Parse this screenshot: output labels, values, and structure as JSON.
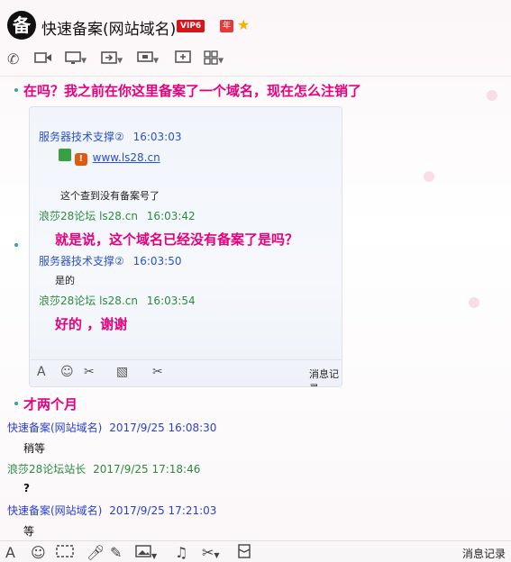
{
  "header": {
    "avatar_text": "备",
    "title": "快速备案(网站域名)",
    "vip_label": "VIP6",
    "year_label": "年"
  },
  "toolbar": {
    "icons": [
      "phone-icon",
      "video-icon",
      "screen-share-icon",
      "file-transfer-icon",
      "remote-desktop-icon",
      "add-chat-icon",
      "apps-icon"
    ]
  },
  "messages": {
    "msg1": "在吗？我之前在你这里备案了一个域名，现在怎么注销了",
    "msg2": "才两个月"
  },
  "inner": {
    "line1_sender": "服务器技术支撑②",
    "line1_time": "16:03:03",
    "link": "www.ls28.cn",
    "line1_text": "这个查到没有备案号了",
    "line2_sender": "浪莎28论坛 ls28.cn",
    "line2_time": "16:03:42",
    "line2_text": "就是说，这个域名已经没有备案了是吗？",
    "line3_sender": "服务器技术支撑②",
    "line3_time": "16:03:50",
    "line3_text": "是的",
    "line4_sender": "浪莎28论坛 ls28.cn",
    "line4_time": "16:03:54",
    "line4_text": "好的 ，谢谢",
    "history_label": "消息记录"
  },
  "history": [
    {
      "sender": "快速备案(网站域名)",
      "time": "2017/9/25 16:08:30",
      "text": "稍等"
    },
    {
      "sender": "浪莎28论坛站长",
      "time": "2017/9/25 17:18:46",
      "text": "?"
    },
    {
      "sender": "快速备案(网站域名)",
      "time": "2017/9/25 17:21:03",
      "text": "等"
    }
  ],
  "bottom": {
    "history_label": "消息记录"
  },
  "colors": {
    "pink_message": "#e7007e",
    "blue_sender": "#2a3fcf",
    "green_sender": "#2b8a3e"
  }
}
